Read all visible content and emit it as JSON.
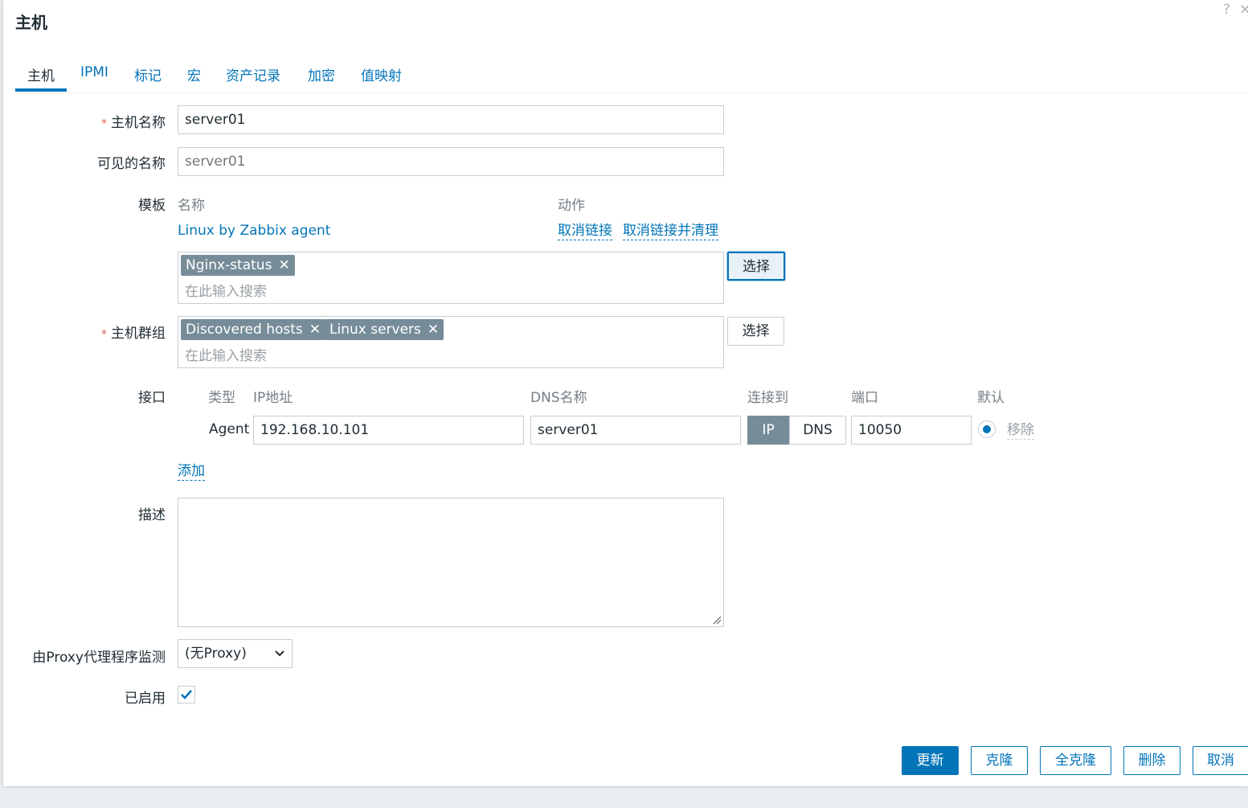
{
  "dialog": {
    "title": "主机",
    "help_symbol": "?",
    "close_symbol": "✕"
  },
  "tabs": [
    {
      "label": "主机",
      "active": true
    },
    {
      "label": "IPMI"
    },
    {
      "label": "标记"
    },
    {
      "label": "宏"
    },
    {
      "label": "资产记录"
    },
    {
      "label": "加密"
    },
    {
      "label": "值映射"
    }
  ],
  "form": {
    "required_mark": "*",
    "host_name": {
      "label": "主机名称",
      "value": "server01"
    },
    "visible_name": {
      "label": "可见的名称",
      "placeholder": "server01"
    },
    "templates": {
      "label": "模板",
      "col_name": "名称",
      "col_action": "动作",
      "linked": [
        {
          "name": "Linux by Zabbix agent",
          "unlink": "取消链接",
          "unlink_clear": "取消链接并清理"
        }
      ],
      "selected_chips": [
        "Nginx-status"
      ],
      "search_placeholder": "在此输入搜索",
      "select_button": "选择"
    },
    "host_groups": {
      "label": "主机群组",
      "chips": [
        "Discovered hosts",
        "Linux servers"
      ],
      "search_placeholder": "在此输入搜索",
      "select_button": "选择"
    },
    "interfaces": {
      "label": "接口",
      "headers": {
        "type": "类型",
        "ip": "IP地址",
        "dns": "DNS名称",
        "connect": "连接到",
        "port": "端口",
        "default": "默认"
      },
      "rows": [
        {
          "type": "Agent",
          "ip": "192.168.10.101",
          "dns": "server01",
          "connect_ip": "IP",
          "connect_dns": "DNS",
          "port": "10050",
          "remove": "移除"
        }
      ],
      "add_link": "添加"
    },
    "description": {
      "label": "描述",
      "value": ""
    },
    "proxy": {
      "label": "由Proxy代理程序监测",
      "selected": "(无Proxy)"
    },
    "enabled": {
      "label": "已启用",
      "checked": true
    }
  },
  "footer": {
    "update": "更新",
    "clone": "克隆",
    "full_clone": "全克隆",
    "delete": "删除",
    "cancel": "取消"
  },
  "colors": {
    "accent": "#0275b8",
    "chip": "#768d99",
    "required": "#e45959"
  }
}
